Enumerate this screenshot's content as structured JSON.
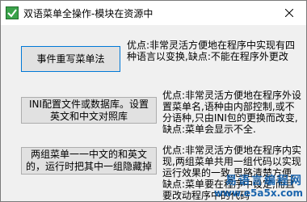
{
  "window": {
    "title": "双语菜单全操作-模块在资源中"
  },
  "icons": {
    "app": "app-icon",
    "close": "close-icon"
  },
  "buttons": [
    {
      "label": "事件重写菜单法",
      "description": "优点:非常灵活方便地在程序中实现有四种语言以变换,缺点:不能在程序外更改"
    },
    {
      "label": "INI配置文件或数据库。设置英文和中文对照库",
      "description": "优点:非常灵活方便地在程序外设置菜单名,语种由内部控制,或不分语种,只由INI包的更换而改变,缺点:菜单会显示不全."
    },
    {
      "label": "两组菜单一一中文的和英文的，运行时把其中一组隐藏掉",
      "description": "优点:非常灵活方便地在程序内实现,两组菜单共用一组代码以实现运行效果的一致,思路清楚方便,缺点:菜单要在程序中设定,而且要改动程序中的代码"
    }
  ],
  "watermark": {
    "line1": "易语言编程网",
    "line2": "www.e5a5x.com"
  },
  "colors": {
    "button_face": "#e1e1e1",
    "button_border": "#adadad",
    "focus_border": "#0078d7",
    "client_bg": "#f0f0f0",
    "watermark": "#0a5aa8"
  }
}
